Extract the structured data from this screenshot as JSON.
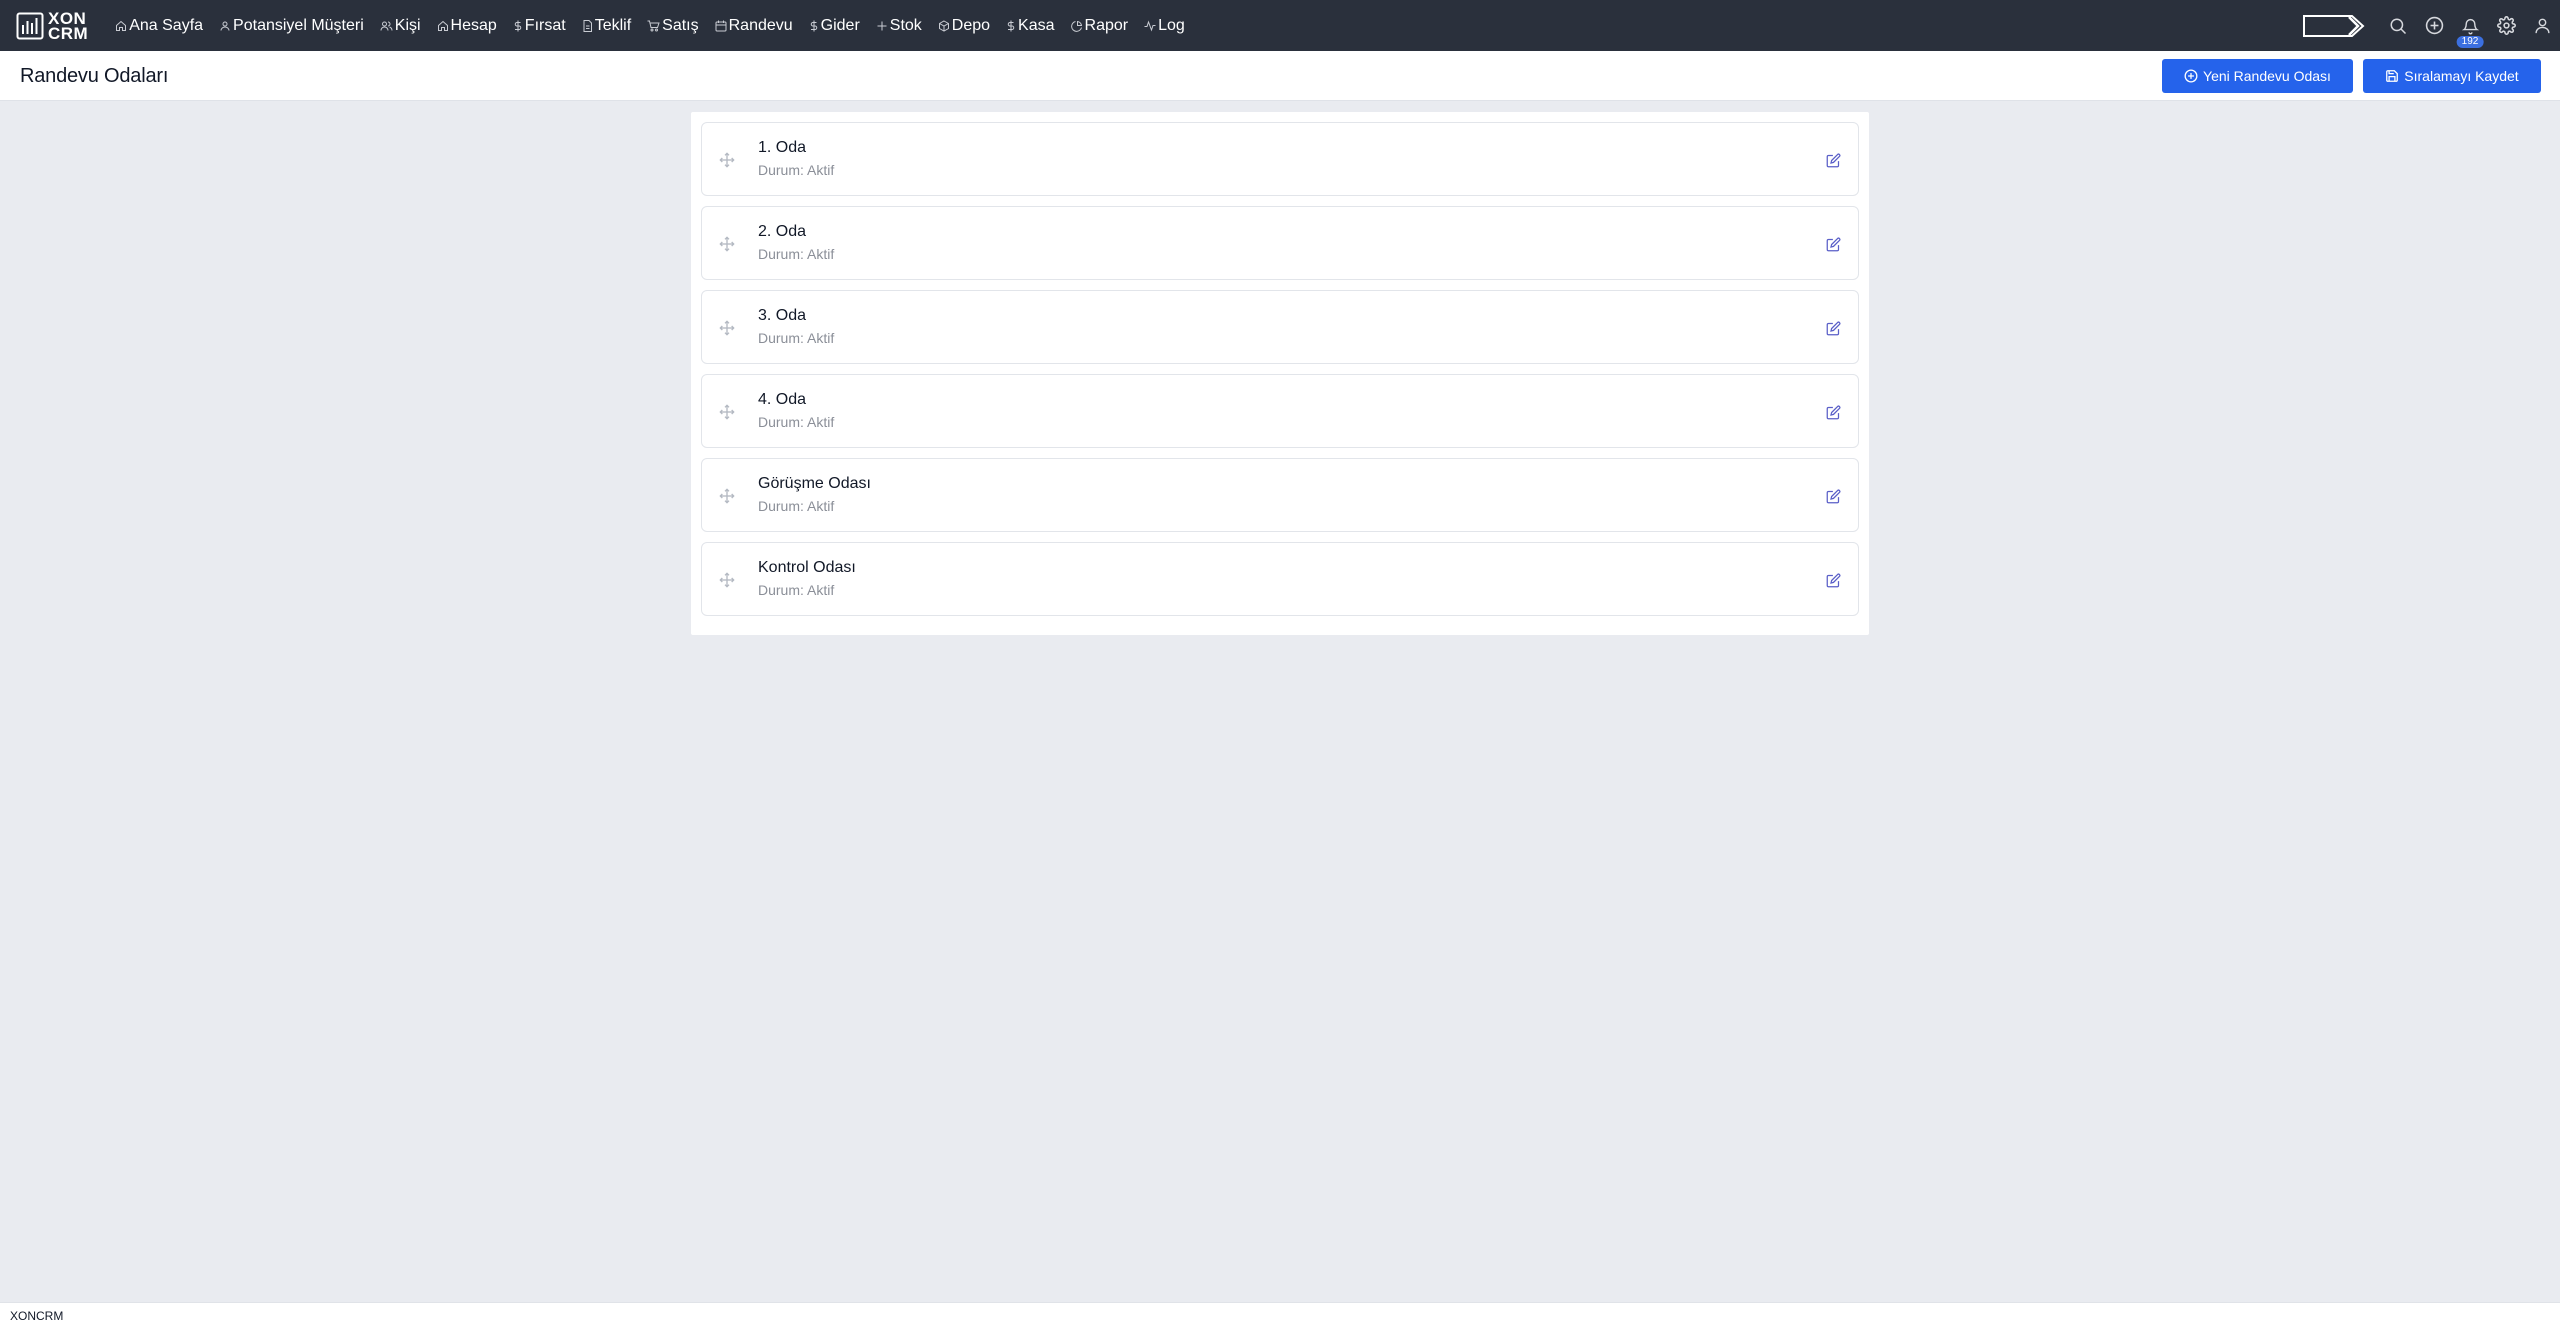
{
  "app": {
    "logo_line1": "XON",
    "logo_line2": "CRM",
    "footer": "XONCRM"
  },
  "nav": {
    "items": [
      {
        "label": "Ana Sayfa",
        "icon": "home-icon"
      },
      {
        "label": "Potansiyel Müşteri",
        "icon": "user-icon"
      },
      {
        "label": "Kişi",
        "icon": "users-icon"
      },
      {
        "label": "Hesap",
        "icon": "home-icon"
      },
      {
        "label": "Fırsat",
        "icon": "dollar-icon"
      },
      {
        "label": "Teklif",
        "icon": "document-icon"
      },
      {
        "label": "Satış",
        "icon": "cart-icon"
      },
      {
        "label": "Randevu",
        "icon": "calendar-icon"
      },
      {
        "label": "Gider",
        "icon": "dollar-icon"
      },
      {
        "label": "Stok",
        "icon": "plus-icon"
      },
      {
        "label": "Depo",
        "icon": "box-icon"
      },
      {
        "label": "Kasa",
        "icon": "dollar-icon"
      },
      {
        "label": "Rapor",
        "icon": "pie-chart-icon"
      },
      {
        "label": "Log",
        "icon": "activity-icon"
      }
    ],
    "notification_count": "192"
  },
  "header": {
    "title": "Randevu Odaları",
    "new_button": "Yeni Randevu Odası",
    "save_button": "Sıralamayı Kaydet"
  },
  "rooms": [
    {
      "name": "1. Oda",
      "status": "Durum: Aktif"
    },
    {
      "name": "2. Oda",
      "status": "Durum: Aktif"
    },
    {
      "name": "3. Oda",
      "status": "Durum: Aktif"
    },
    {
      "name": "4. Oda",
      "status": "Durum: Aktif"
    },
    {
      "name": "Görüşme Odası",
      "status": "Durum: Aktif"
    },
    {
      "name": "Kontrol Odası",
      "status": "Durum: Aktif"
    }
  ],
  "colors": {
    "nav_bg": "#2a303c",
    "primary": "#2563eb",
    "page_bg": "#e9ebf0",
    "edit_icon": "#5a5fc8"
  }
}
